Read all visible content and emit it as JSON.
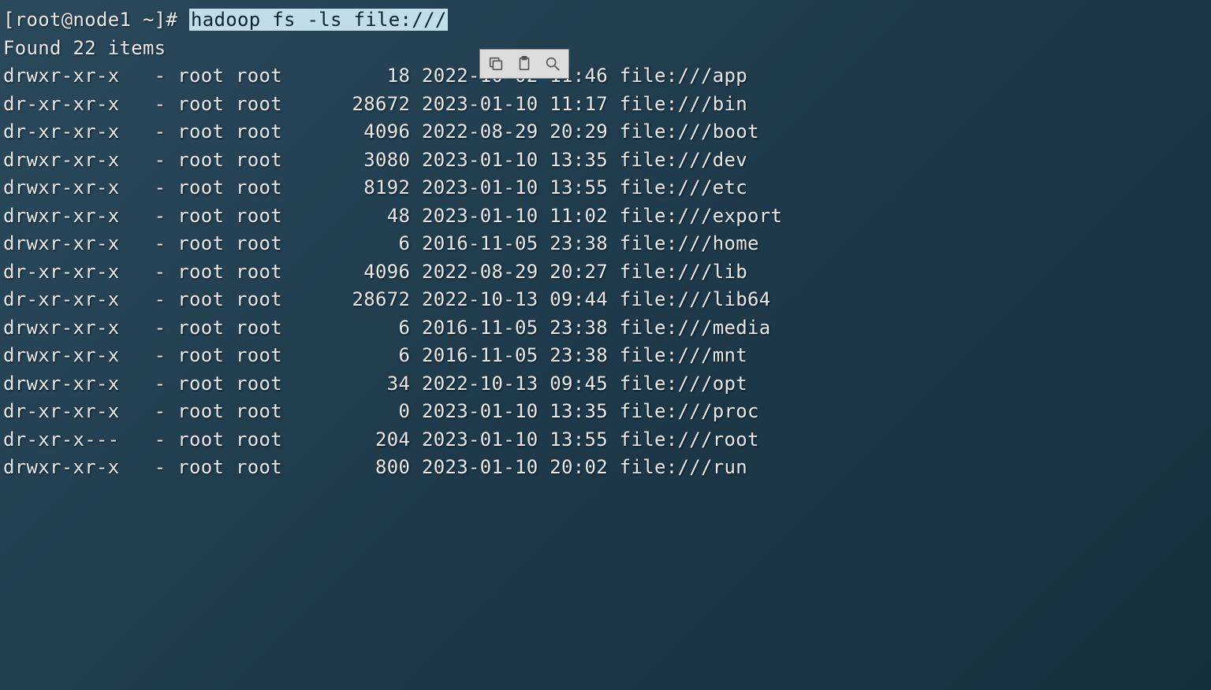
{
  "prompt_prefix": "[root@node1 ~]# ",
  "command": "hadoop fs -ls file:///",
  "summary": "Found 22 items",
  "columns": {
    "perm_width": 10,
    "repl_width": 3,
    "owner_width": 5,
    "group_width": 5,
    "size_width": 10,
    "date_width": 10,
    "time_width": 5
  },
  "rows": [
    {
      "perm": "drwxr-xr-x",
      "repl": "-",
      "owner": "root",
      "group": "root",
      "size": "18",
      "date": "2022-10-02",
      "time": "11:46",
      "path": "file:///app"
    },
    {
      "perm": "dr-xr-xr-x",
      "repl": "-",
      "owner": "root",
      "group": "root",
      "size": "28672",
      "date": "2023-01-10",
      "time": "11:17",
      "path": "file:///bin"
    },
    {
      "perm": "dr-xr-xr-x",
      "repl": "-",
      "owner": "root",
      "group": "root",
      "size": "4096",
      "date": "2022-08-29",
      "time": "20:29",
      "path": "file:///boot"
    },
    {
      "perm": "drwxr-xr-x",
      "repl": "-",
      "owner": "root",
      "group": "root",
      "size": "3080",
      "date": "2023-01-10",
      "time": "13:35",
      "path": "file:///dev"
    },
    {
      "perm": "drwxr-xr-x",
      "repl": "-",
      "owner": "root",
      "group": "root",
      "size": "8192",
      "date": "2023-01-10",
      "time": "13:55",
      "path": "file:///etc"
    },
    {
      "perm": "drwxr-xr-x",
      "repl": "-",
      "owner": "root",
      "group": "root",
      "size": "48",
      "date": "2023-01-10",
      "time": "11:02",
      "path": "file:///export"
    },
    {
      "perm": "drwxr-xr-x",
      "repl": "-",
      "owner": "root",
      "group": "root",
      "size": "6",
      "date": "2016-11-05",
      "time": "23:38",
      "path": "file:///home"
    },
    {
      "perm": "dr-xr-xr-x",
      "repl": "-",
      "owner": "root",
      "group": "root",
      "size": "4096",
      "date": "2022-08-29",
      "time": "20:27",
      "path": "file:///lib"
    },
    {
      "perm": "dr-xr-xr-x",
      "repl": "-",
      "owner": "root",
      "group": "root",
      "size": "28672",
      "date": "2022-10-13",
      "time": "09:44",
      "path": "file:///lib64"
    },
    {
      "perm": "drwxr-xr-x",
      "repl": "-",
      "owner": "root",
      "group": "root",
      "size": "6",
      "date": "2016-11-05",
      "time": "23:38",
      "path": "file:///media"
    },
    {
      "perm": "drwxr-xr-x",
      "repl": "-",
      "owner": "root",
      "group": "root",
      "size": "6",
      "date": "2016-11-05",
      "time": "23:38",
      "path": "file:///mnt"
    },
    {
      "perm": "drwxr-xr-x",
      "repl": "-",
      "owner": "root",
      "group": "root",
      "size": "34",
      "date": "2022-10-13",
      "time": "09:45",
      "path": "file:///opt"
    },
    {
      "perm": "dr-xr-xr-x",
      "repl": "-",
      "owner": "root",
      "group": "root",
      "size": "0",
      "date": "2023-01-10",
      "time": "13:35",
      "path": "file:///proc"
    },
    {
      "perm": "dr-xr-x---",
      "repl": "-",
      "owner": "root",
      "group": "root",
      "size": "204",
      "date": "2023-01-10",
      "time": "13:55",
      "path": "file:///root"
    },
    {
      "perm": "drwxr-xr-x",
      "repl": "-",
      "owner": "root",
      "group": "root",
      "size": "800",
      "date": "2023-01-10",
      "time": "20:02",
      "path": "file:///run"
    }
  ],
  "toolbar": {
    "copy_title": "Copy",
    "paste_title": "Paste",
    "search_title": "Find"
  }
}
